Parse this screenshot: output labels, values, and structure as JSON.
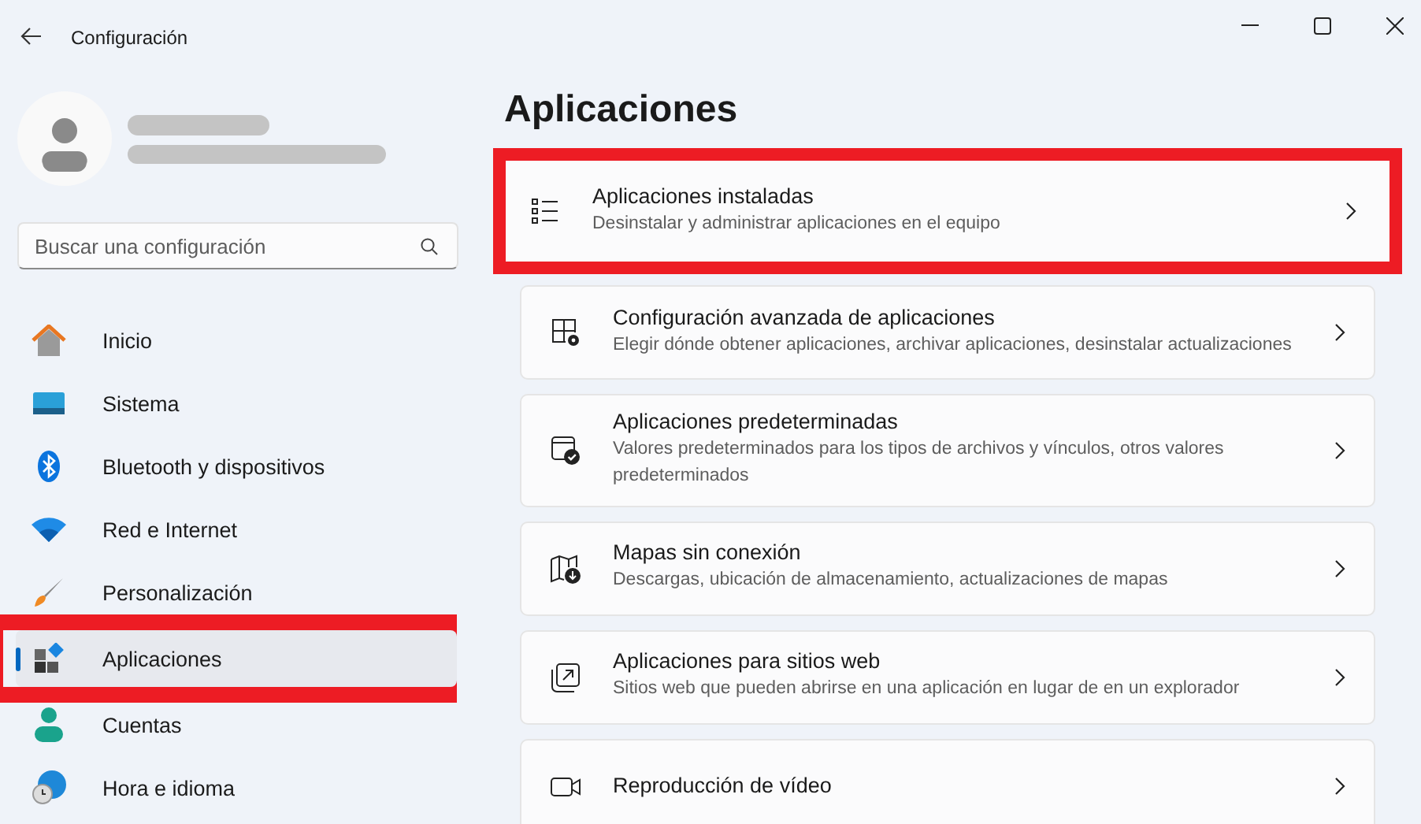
{
  "window": {
    "title": "Configuración"
  },
  "search": {
    "placeholder": "Buscar una configuración"
  },
  "sidebar": {
    "items": [
      {
        "label": "Inicio",
        "selected": false,
        "highlighted": false
      },
      {
        "label": "Sistema",
        "selected": false,
        "highlighted": false
      },
      {
        "label": "Bluetooth y dispositivos",
        "selected": false,
        "highlighted": false
      },
      {
        "label": "Red e Internet",
        "selected": false,
        "highlighted": false
      },
      {
        "label": "Personalización",
        "selected": false,
        "highlighted": false
      },
      {
        "label": "Aplicaciones",
        "selected": true,
        "highlighted": true
      },
      {
        "label": "Cuentas",
        "selected": false,
        "highlighted": false
      },
      {
        "label": "Hora e idioma",
        "selected": false,
        "highlighted": false
      }
    ]
  },
  "page": {
    "title": "Aplicaciones",
    "cards": [
      {
        "title": "Aplicaciones instaladas",
        "description": "Desinstalar y administrar aplicaciones en el equipo",
        "highlighted": true
      },
      {
        "title": "Configuración avanzada de aplicaciones",
        "description": "Elegir dónde obtener aplicaciones, archivar aplicaciones, desinstalar actualizaciones",
        "highlighted": false
      },
      {
        "title": "Aplicaciones predeterminadas",
        "description": "Valores predeterminados para los tipos de archivos y vínculos, otros valores predeterminados",
        "highlighted": false
      },
      {
        "title": "Mapas sin conexión",
        "description": "Descargas, ubicación de almacenamiento, actualizaciones de mapas",
        "highlighted": false
      },
      {
        "title": "Aplicaciones para sitios web",
        "description": "Sitios web que pueden abrirse en una aplicación en lugar de en un explorador",
        "highlighted": false
      },
      {
        "title": "Reproducción de vídeo",
        "highlighted": false
      }
    ]
  }
}
